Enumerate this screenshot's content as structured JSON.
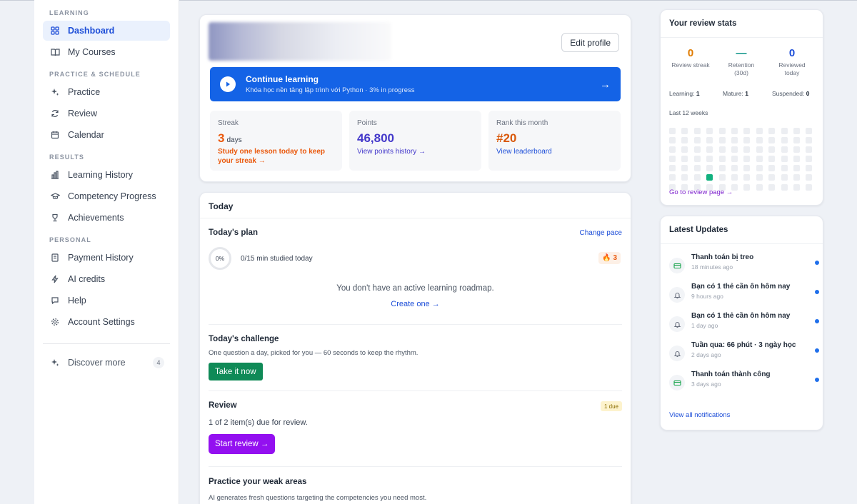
{
  "sidebar": {
    "sections": [
      {
        "title": "LEARNING",
        "items": [
          {
            "label": "Dashboard",
            "icon": "grid-icon",
            "active": true
          },
          {
            "label": "My Courses",
            "icon": "book-icon"
          }
        ]
      },
      {
        "title": "PRACTICE & SCHEDULE",
        "items": [
          {
            "label": "Practice",
            "icon": "sparkles-icon"
          },
          {
            "label": "Review",
            "icon": "refresh-icon"
          },
          {
            "label": "Calendar",
            "icon": "calendar-icon"
          }
        ]
      },
      {
        "title": "RESULTS",
        "items": [
          {
            "label": "Learning History",
            "icon": "bar-chart-icon"
          },
          {
            "label": "Competency Progress",
            "icon": "graduation-cap-icon"
          },
          {
            "label": "Achievements",
            "icon": "trophy-icon"
          }
        ]
      },
      {
        "title": "PERSONAL",
        "items": [
          {
            "label": "Payment History",
            "icon": "receipt-icon"
          },
          {
            "label": "AI credits",
            "icon": "lightning-icon"
          },
          {
            "label": "Help",
            "icon": "chat-icon"
          },
          {
            "label": "Account Settings",
            "icon": "gear-icon"
          }
        ]
      }
    ],
    "discover": {
      "label": "Discover more",
      "count": "4"
    }
  },
  "profile": {
    "edit_label": "Edit profile",
    "continue": {
      "title": "Continue learning",
      "subtitle": "Khóa học nền tảng lập trình với Python · 3% in progress"
    },
    "stats": [
      {
        "label": "Streak",
        "value": "3",
        "unit": "days",
        "note": "Study one lesson today to keep your streak →",
        "color": "#ea580c"
      },
      {
        "label": "Points",
        "value": "46,800",
        "link": "View points history →",
        "color": "#4338ca"
      },
      {
        "label": "Rank this month",
        "value": "#20",
        "link": "View leaderboard",
        "color": "#d9580b"
      }
    ]
  },
  "today": {
    "header": "Today",
    "plan": {
      "title": "Today's plan",
      "change": "Change pace",
      "percent": "0%",
      "studied": "0/15 min studied today",
      "fire_count": "3",
      "empty": "You don't have an active learning roadmap.",
      "create": "Create one →"
    },
    "challenge": {
      "title": "Today's challenge",
      "desc": "One question a day, picked for you — 60 seconds to keep the rhythm.",
      "button": "Take it now"
    },
    "review": {
      "title": "Review",
      "badge": "1 due",
      "desc": "1 of 2 item(s) due for review.",
      "button": "Start review →"
    },
    "weak": {
      "title": "Practice your weak areas",
      "desc": "AI generates fresh questions targeting the competencies you need most."
    }
  },
  "review_stats": {
    "title": "Your review stats",
    "streak": {
      "value": "0",
      "label": "Review streak"
    },
    "retention": {
      "value": "—",
      "label": "Retention",
      "sub": "(30d)"
    },
    "reviewed": {
      "value": "0",
      "label": "Reviewed",
      "sub": "today"
    },
    "learning_label": "Learning:",
    "learning": "1",
    "mature_label": "Mature:",
    "mature": "1",
    "suspended_label": "Suspended:",
    "suspended": "0",
    "weeks_label": "Last 12 weeks",
    "active_cell": {
      "week": 3,
      "day": 5
    },
    "link": "Go to review page →"
  },
  "updates": {
    "title": "Latest Updates",
    "items": [
      {
        "title": "Thanh toán bị treo",
        "time": "18 minutes ago",
        "icon": "card-icon"
      },
      {
        "title": "Bạn có 1 thẻ cần ôn hôm nay",
        "time": "9 hours ago",
        "icon": "bell-icon"
      },
      {
        "title": "Bạn có 1 thẻ cần ôn hôm nay",
        "time": "1 day ago",
        "icon": "bell-icon"
      },
      {
        "title": "Tuần qua: 66 phút · 3 ngày học",
        "time": "2 days ago",
        "icon": "bell-icon"
      },
      {
        "title": "Thanh toán thành công",
        "time": "3 days ago",
        "icon": "card-icon"
      }
    ],
    "view_all": "View all notifications"
  }
}
